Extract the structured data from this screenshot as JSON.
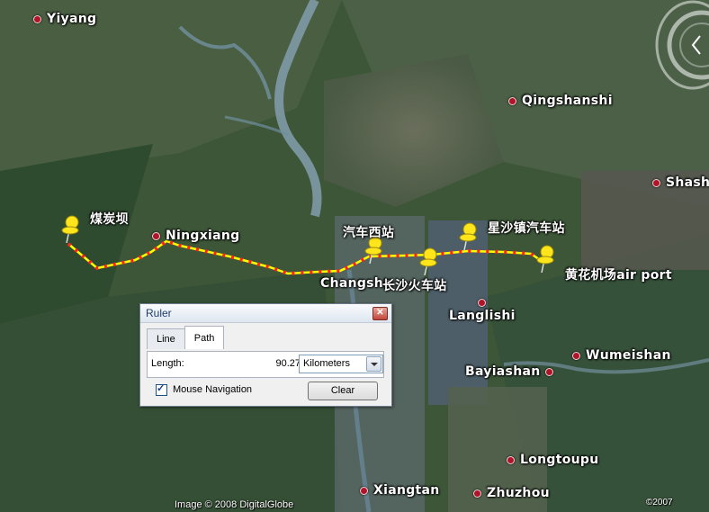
{
  "map": {
    "places": [
      {
        "label": "Yiyang",
        "dot": true
      },
      {
        "label": "Qingshanshi",
        "dot": true
      },
      {
        "label": "Shash",
        "dot": true
      },
      {
        "label": "煤炭坝",
        "dot": false
      },
      {
        "label": "Ningxiang",
        "dot": true
      },
      {
        "label": "汽车西站",
        "dot": false
      },
      {
        "label": "星沙镇汽车站",
        "dot": false
      },
      {
        "label": "Changsha",
        "dot": false
      },
      {
        "label": "长沙火车站",
        "dot": false
      },
      {
        "label": "黄花机场air port",
        "dot": false
      },
      {
        "label": "Langlishi",
        "dot": true
      },
      {
        "label": "Wumeishan",
        "dot": true
      },
      {
        "label": "Bayiashan",
        "dot": true
      },
      {
        "label": "Longtoupu",
        "dot": true
      },
      {
        "label": "Xiangtan",
        "dot": true
      },
      {
        "label": "Zhuzhou",
        "dot": true
      }
    ],
    "credit_left": "Image © 2008 DigitalGlobe",
    "credit_right": "©2007",
    "colors": {
      "path": "#ffff00",
      "path_points": "#ff0000",
      "pin": "#ffe51a",
      "place_dot": "#b0142a"
    }
  },
  "ruler": {
    "title": "Ruler",
    "close_icon": "close-icon",
    "tabs": [
      {
        "label": "Line",
        "active": false
      },
      {
        "label": "Path",
        "active": true
      }
    ],
    "length_label": "Length:",
    "length_value": "90.27",
    "unit": "Kilometers",
    "mouse_navigation_label": "Mouse Navigation",
    "mouse_navigation_checked": true,
    "clear_label": "Clear"
  },
  "navigation": {
    "icon": "navigation-compass-icon"
  }
}
